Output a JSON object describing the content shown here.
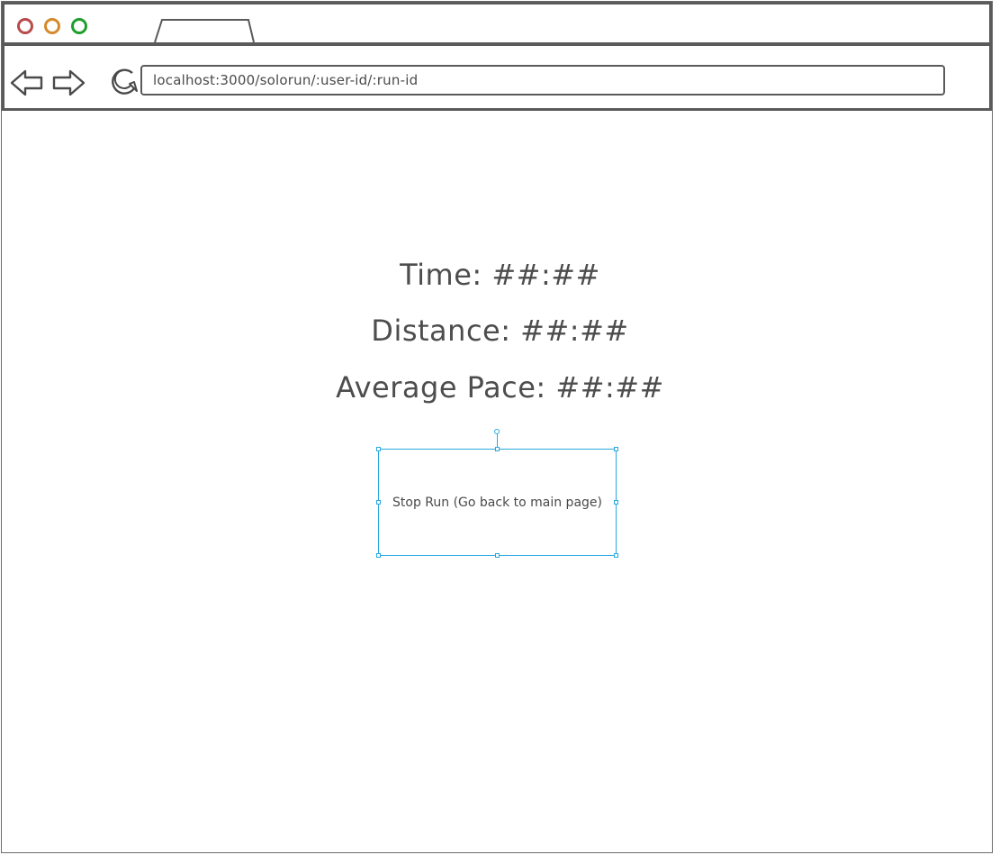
{
  "browser": {
    "window_controls": {
      "close_color": "#b84b4b",
      "minimize_color": "#d48a2a",
      "maximize_color": "#1f9e2a"
    },
    "nav": {
      "back_icon": "arrow-left-icon",
      "forward_icon": "arrow-right-icon",
      "reload_icon": "reload-icon"
    },
    "address": "localhost:3000/solorun/:user-id/:run-id"
  },
  "stats": {
    "time": "Time: ##:##",
    "distance": "Distance: ##:##",
    "average_pace": "Average Pace: ##:##"
  },
  "actions": {
    "stop_run_label": "Stop Run (Go back to main page)"
  },
  "colors": {
    "selection": "#2aa8e0",
    "stroke": "#5a5a5a"
  }
}
